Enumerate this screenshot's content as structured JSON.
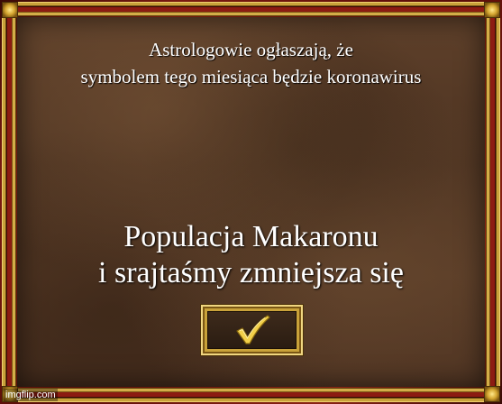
{
  "dialog": {
    "top_message_lines": [
      "Astrologowie ogłaszają, że",
      "symbolem tego miesiąca będzie koronawirus"
    ],
    "main_message_lines": [
      "Populacja Makaronu",
      "i srajtaśmy zmniejsza się"
    ],
    "ok_button": {
      "icon": "checkmark-icon",
      "icon_color": "#f3d04a"
    }
  },
  "colors": {
    "frame_gold": "#c9a23a",
    "frame_red": "#8c1c12",
    "leather": "#573a26",
    "text": "#ffffff"
  },
  "watermark": {
    "text": "imgflip.com"
  }
}
